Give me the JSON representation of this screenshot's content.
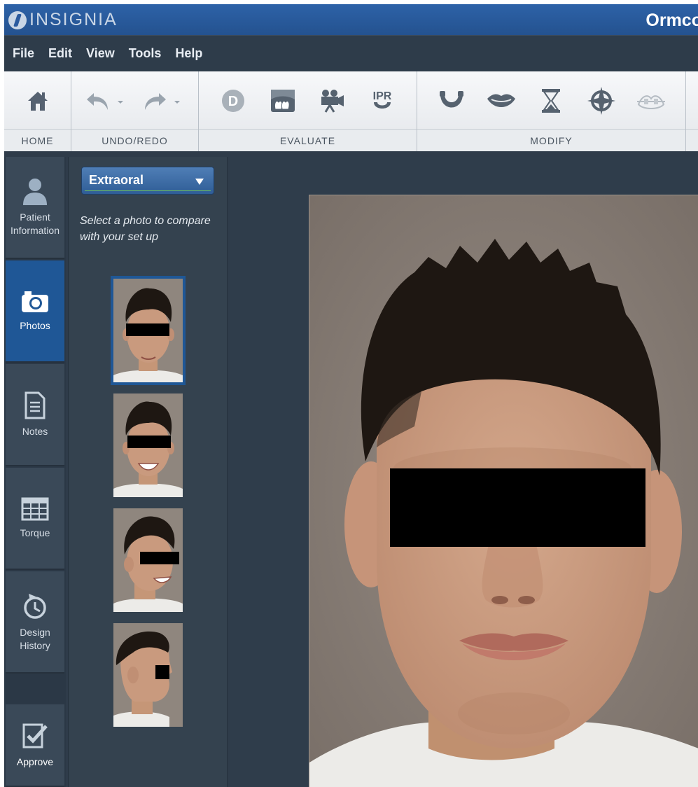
{
  "app": {
    "logo_text": "INSIGNIA",
    "brand_right": "Ormco"
  },
  "menu": [
    "File",
    "Edit",
    "View",
    "Tools",
    "Help"
  ],
  "toolbar": {
    "groups": [
      {
        "label": "HOME",
        "icons": [
          "home-icon"
        ]
      },
      {
        "label": "UNDO/REDO",
        "icons": [
          "undo-icon",
          "redo-icon"
        ]
      },
      {
        "label": "EVALUATE",
        "icons": [
          "d-circle-icon",
          "teeth-overlay-icon",
          "movie-camera-icon",
          "ipr-icon"
        ]
      },
      {
        "label": "MODIFY",
        "icons": [
          "arch-icon",
          "lips-icon",
          "hourglass-icon",
          "compass-target-icon",
          "bracket-wire-icon"
        ]
      }
    ],
    "ipr_text": "IPR",
    "d_text": "D"
  },
  "sidenav": [
    {
      "label": "Patient Information",
      "icon": "person-icon",
      "active": false
    },
    {
      "label": "Photos",
      "icon": "camera-icon",
      "active": true
    },
    {
      "label": "Notes",
      "icon": "document-icon",
      "active": false
    },
    {
      "label": "Torque",
      "icon": "grid-table-icon",
      "active": false
    },
    {
      "label": "Design History",
      "icon": "history-icon",
      "active": false
    },
    {
      "label": "Approve",
      "icon": "approve-check-icon",
      "active": false
    }
  ],
  "photo_panel": {
    "dropdown_value": "Extraoral",
    "prompt": "Select a photo to compare with your set up",
    "thumbnails": [
      "frontal",
      "frontal-smile",
      "three-quarter-smile",
      "profile"
    ],
    "selected_index": 0
  },
  "colors": {
    "titlebar": "#2a5a9e",
    "accent": "#1f5796",
    "panel": "#34424f",
    "background": "#2f3c4a",
    "skin": "#c99a7e",
    "hair": "#1e1712",
    "photo_bg": "#8a7f77"
  }
}
